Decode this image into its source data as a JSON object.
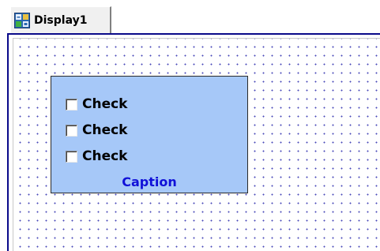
{
  "tab": {
    "label": "Display1",
    "icon": "display-icon"
  },
  "groupbox": {
    "checkboxes": [
      {
        "label": "Check",
        "checked": false
      },
      {
        "label": "Check",
        "checked": false
      },
      {
        "label": "Check",
        "checked": false
      }
    ],
    "caption": "Caption"
  },
  "colors": {
    "canvas_border": "#0a0a8a",
    "grid_dot": "#4a4ab8",
    "groupbox_fill": "#a6c8f8",
    "caption_text": "#1010d8"
  }
}
